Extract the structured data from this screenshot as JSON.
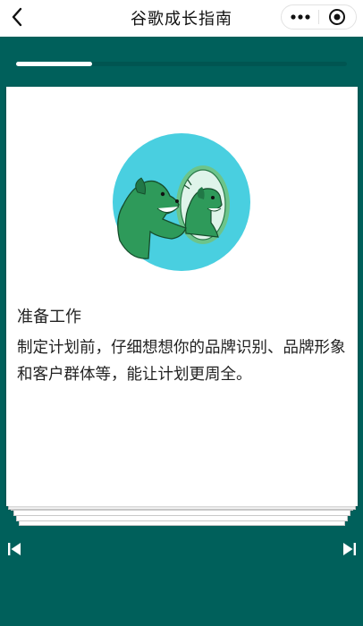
{
  "nav": {
    "title": "谷歌成长指南",
    "back_icon": "chevron-left-icon",
    "more_icon": "more-dots-icon",
    "close_icon": "target-circle-icon"
  },
  "progress": {
    "value": 0.23
  },
  "card": {
    "title": "准备工作",
    "body": "制定计划前，仔细想想你的品牌识别、品牌形象和客户群体等，能让计划更周全。",
    "illustration": "dog-looking-in-mirror-illustration"
  },
  "pager": {
    "prev_icon": "skip-previous-icon",
    "next_icon": "skip-next-icon"
  },
  "colors": {
    "background": "#00605b",
    "illustration_circle": "#49cfe0",
    "dog_green": "#2e9a5a",
    "mirror_frame": "#6cc48a"
  }
}
